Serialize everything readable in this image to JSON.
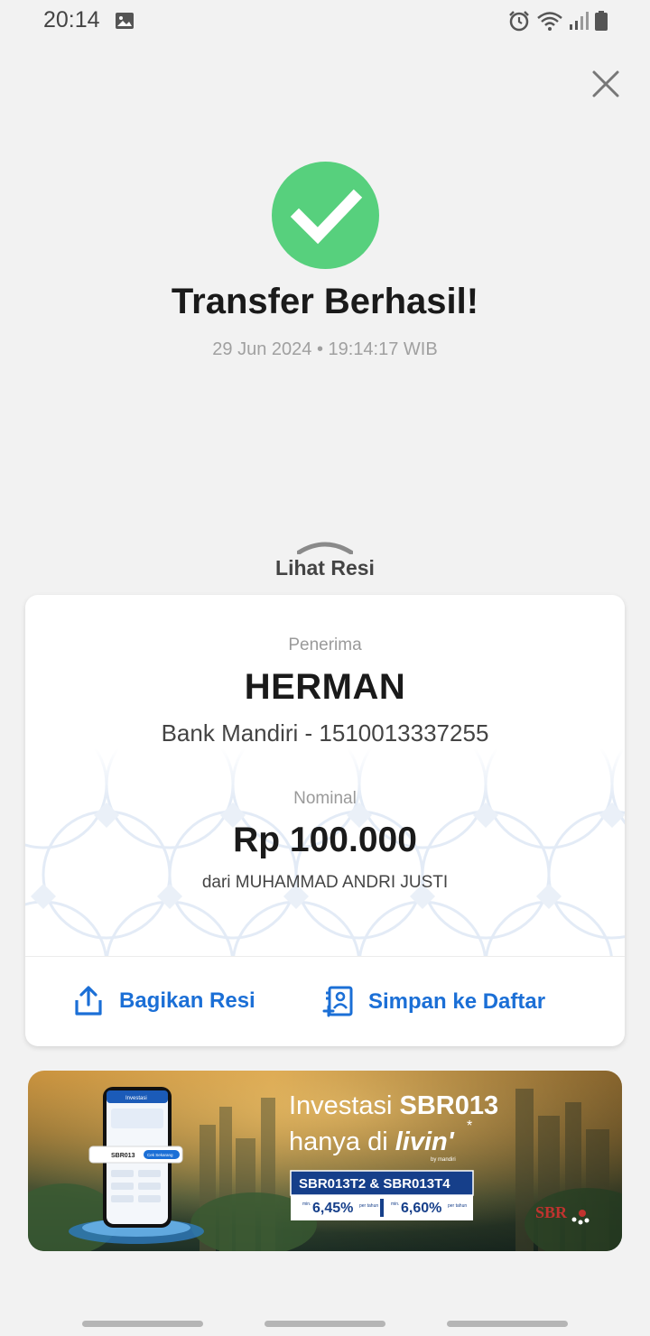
{
  "status_bar": {
    "time": "20:14",
    "icons": [
      "image-icon",
      "alarm-icon",
      "wifi-icon",
      "signal-icon",
      "battery-icon"
    ]
  },
  "header": {
    "close_icon": "close-icon"
  },
  "result": {
    "title": "Transfer Berhasil!",
    "datetime": "29 Jun 2024 • 19:14:17 WIB",
    "success_color": "#57d07d"
  },
  "receipt_toggle": {
    "label": "Lihat Resi"
  },
  "receipt": {
    "recipient_label": "Penerima",
    "recipient_name": "HERMAN",
    "recipient_account": "Bank Mandiri - 1510013337255",
    "amount_label": "Nominal",
    "amount": "Rp 100.000",
    "sender": "dari MUHAMMAD ANDRI JUSTI"
  },
  "actions": {
    "share_label": "Bagikan Resi",
    "save_label": "Simpan ke Daftar",
    "accent_color": "#1b6fd6"
  },
  "promo": {
    "line1_prefix": "Investasi",
    "line1_highlight": "SBR013",
    "line2_prefix": "hanya di",
    "brand": "livin'",
    "brand_sub": "by mandiri",
    "series": "SBR013T2 & SBR013T4",
    "rate1_prefix": "min.",
    "rate1": "6,45%",
    "rate1_suffix": "per tahun",
    "rate2_prefix": "min.",
    "rate2": "6,60%",
    "rate2_suffix": "per tahun",
    "phone_header": "Investasi",
    "phone_item": "SBR013",
    "phone_button": "Cek Sekarang",
    "logo": "SBR"
  }
}
